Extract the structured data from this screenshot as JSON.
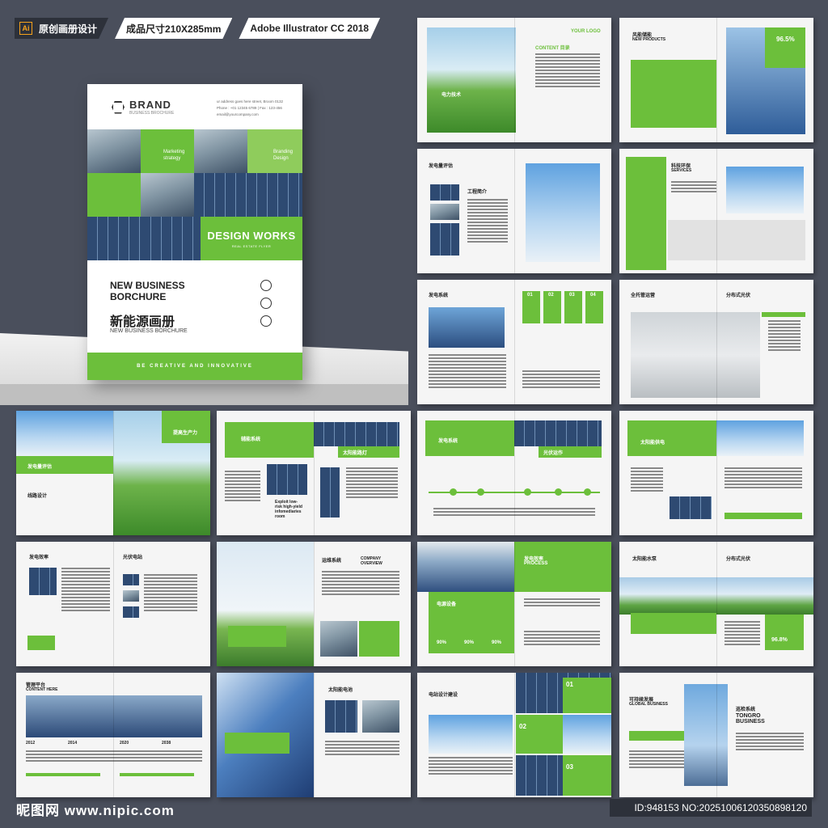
{
  "badges": {
    "b1": "原创画册设计",
    "b2": "成品尺寸210X285mm",
    "b3": "Adobe Illustrator CC 2018",
    "ai": "Ai"
  },
  "cover": {
    "brand": "BRAND",
    "brand_sub": "BUSINESS BROCHURE",
    "addr1": "ur address goes here street, Broom 0132",
    "addr2": "Phone : +01 12345 6789 | Fax : 123-456",
    "addr3": "email@yourcompany.com",
    "tile1": "Marketing\nstrategy",
    "tile2": "Branding\nDesign",
    "design_works": "DESIGN WORKS",
    "design_sub": "REAL ESTATE FLYER",
    "title_en": "NEW BUSINESS\nBORCHURE",
    "title_cn": "新能源画册",
    "title_sub": "NEW BUSINESS BORCHURE",
    "footer": "BE CREATIVE AND INNOVATIVE"
  },
  "spreads": {
    "s1_left": "电力技术",
    "s1_right": "CONTENT 目录",
    "s1_logo": "YOUR LOGO",
    "s2": "风能储能",
    "s2_en": "NEW PRODUCTS",
    "s2_pct": "96.5%",
    "s3": "发电量评估",
    "s3_b": "工程简介",
    "s4": "科技环保",
    "s4_en": "SERVICES",
    "s5": "发电系统",
    "s5_steps": [
      "01",
      "02",
      "03",
      "04"
    ],
    "s6": "全托管运营",
    "s6_b": "分布式光伏",
    "s7": "发电量评估",
    "s7_r": "提高生产力",
    "s7_b": "线路设计",
    "s8": "辅能系统",
    "s8_b": "太阳能路灯",
    "s8_c": "Exploit low-\nrisk high-yield\ninfomediaries\nroom",
    "s9": "发电系统",
    "s9_b": "光伏运作",
    "s10": "太阳能供电",
    "s11": "发电效率",
    "s11_b": "光伏电站",
    "s12": "运维系统",
    "s12_b": "COMPANY\nOVERVIEW",
    "s13": "发电效率",
    "s13_en": "PROCESS",
    "s13_b": "电源设备",
    "s13_pcts": [
      "90%",
      "90%",
      "90%"
    ],
    "s14": "太阳能水泵",
    "s14_b": "分布式光伏",
    "s14_pct": "96.8%",
    "s15": "管理平台",
    "s15_en": "CONTENT HERE",
    "s15_years": [
      "2012",
      "2014",
      "2020",
      "2038"
    ],
    "s16": "太阳能电池",
    "s17": "电站设计建设",
    "s17_nums": [
      "01",
      "02",
      "03"
    ],
    "s18": "可持续发展",
    "s18_en": "GLOBAL BUSINESS",
    "s18_b": "巡检系统",
    "s18_c": "TONGRO\nBUSINESS"
  },
  "footer": {
    "watermark": "昵图网 www.nipic.com",
    "id": "ID:948153 NO:20251006120350898120"
  }
}
